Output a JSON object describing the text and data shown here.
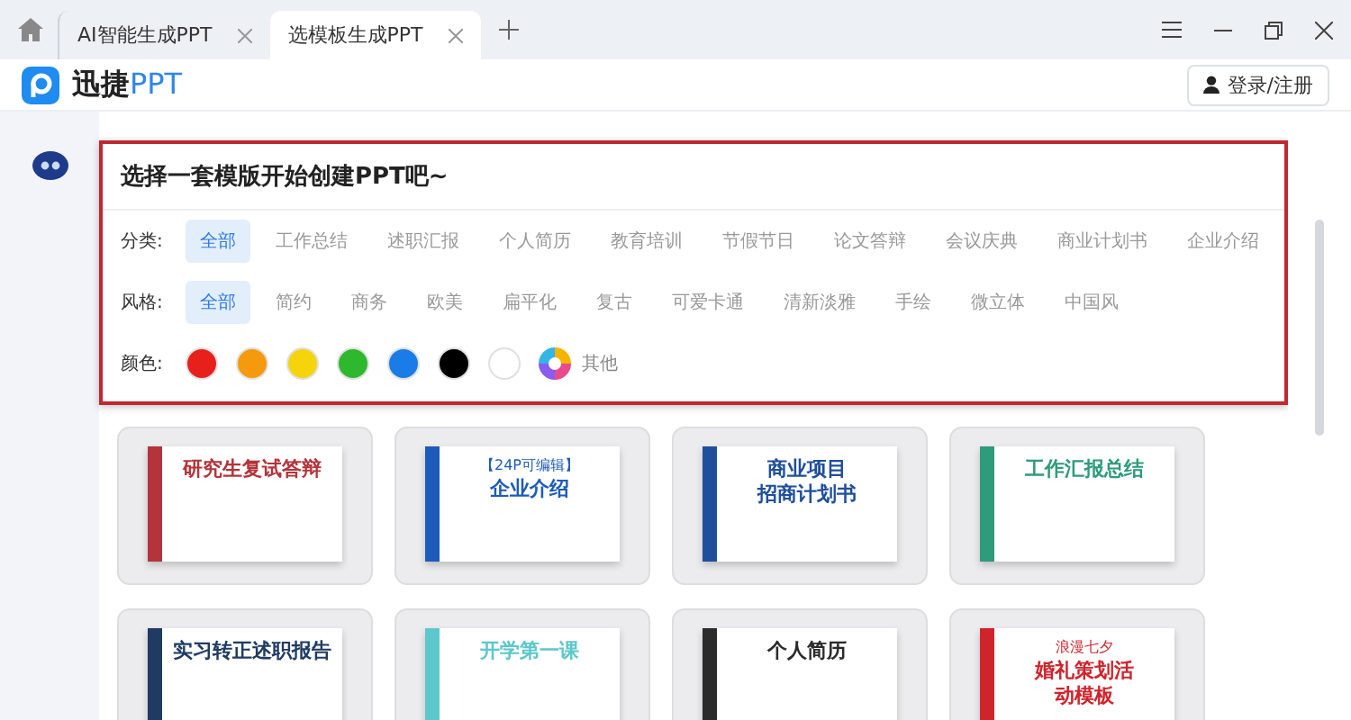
{
  "tabs": [
    {
      "label": "AI智能生成PPT",
      "selected": false
    },
    {
      "label": "选模板生成PPT",
      "selected": true
    }
  ],
  "header": {
    "brand_name": "迅捷",
    "brand_suffix": "PPT",
    "login": "登录/注册"
  },
  "panel": {
    "title": "选择一套模版开始创建PPT吧~",
    "category": {
      "label": "分类:",
      "options": [
        {
          "label": "全部",
          "selected": true
        },
        {
          "label": "工作总结",
          "selected": false
        },
        {
          "label": "述职汇报",
          "selected": false
        },
        {
          "label": "个人简历",
          "selected": false
        },
        {
          "label": "教育培训",
          "selected": false
        },
        {
          "label": "节假节日",
          "selected": false
        },
        {
          "label": "论文答辩",
          "selected": false
        },
        {
          "label": "会议庆典",
          "selected": false
        },
        {
          "label": "商业计划书",
          "selected": false
        },
        {
          "label": "企业介绍",
          "selected": false
        }
      ]
    },
    "style": {
      "label": "风格:",
      "options": [
        {
          "label": "全部",
          "selected": true
        },
        {
          "label": "简约",
          "selected": false
        },
        {
          "label": "商务",
          "selected": false
        },
        {
          "label": "欧美",
          "selected": false
        },
        {
          "label": "扁平化",
          "selected": false
        },
        {
          "label": "复古",
          "selected": false
        },
        {
          "label": "可爱卡通",
          "selected": false
        },
        {
          "label": "清新淡雅",
          "selected": false
        },
        {
          "label": "手绘",
          "selected": false
        },
        {
          "label": "微立体",
          "selected": false
        },
        {
          "label": "中国风",
          "selected": false
        }
      ]
    },
    "color": {
      "label": "颜色:",
      "swatches": [
        {
          "color": "#e8201c",
          "selected": false
        },
        {
          "color": "#f59a0c",
          "selected": false
        },
        {
          "color": "#f5d40c",
          "selected": false
        },
        {
          "color": "#2eb82e",
          "selected": false
        },
        {
          "color": "#1a7ce6",
          "selected": false
        },
        {
          "color": "#000000",
          "selected": false
        },
        {
          "color": "#ffffff",
          "selected": false
        }
      ],
      "other": "其他"
    }
  },
  "templates": [
    {
      "lines": [
        "研究生复试答辩"
      ],
      "color": "#b3343a"
    },
    {
      "tag": "【24P可编辑】",
      "lines": [
        "企业介绍"
      ],
      "color": "#1d5bb8"
    },
    {
      "lines": [
        "商业项目",
        "招商计划书"
      ],
      "color": "#1f4f9c"
    },
    {
      "lines": [
        "工作汇报总结"
      ],
      "color": "#2e9b7a"
    },
    {
      "lines": [
        "实习转正述职报告"
      ],
      "color": "#1f3b63"
    },
    {
      "lines": [
        "开学第一课"
      ],
      "color": "#5cc7cc"
    },
    {
      "lines": [
        "个人简历"
      ],
      "color": "#2b2b2b"
    },
    {
      "tag": "浪漫七夕",
      "lines": [
        "婚礼策划活",
        "动模板"
      ],
      "color": "#d0242c"
    }
  ]
}
